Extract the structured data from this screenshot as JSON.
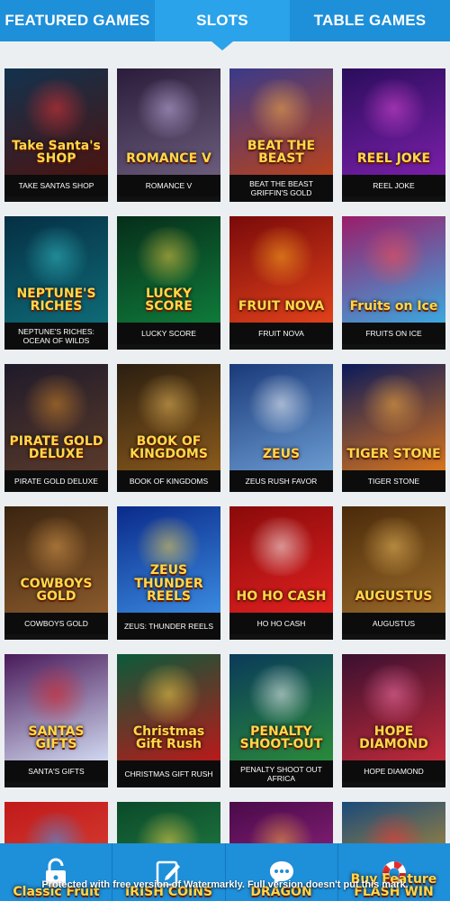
{
  "tabs": [
    {
      "label": "FEATURED GAMES"
    },
    {
      "label": "SLOTS"
    },
    {
      "label": "TABLE GAMES"
    }
  ],
  "games": [
    {
      "caption": "TAKE SANTAS SHOP",
      "logo": "Take Santa's SHOP",
      "bg1": "#12324f",
      "bg2": "#4a1410",
      "glow": "#e33"
    },
    {
      "caption": "ROMANCE V",
      "logo": "ROMANCE V",
      "bg1": "#2a1c3a",
      "bg2": "#6b5c7c",
      "glow": "#c9b6e8"
    },
    {
      "caption": "BEAT THE BEAST GRIFFIN'S GOLD",
      "logo": "BEAT THE BEAST",
      "bg1": "#3a3a8a",
      "bg2": "#b8421c",
      "glow": "#ffb347"
    },
    {
      "caption": "REEL JOKE",
      "logo": "REEL JOKE",
      "bg1": "#2a0d5c",
      "bg2": "#7a1fa8",
      "glow": "#e04bd8"
    },
    {
      "caption": "NEPTUNE'S RICHES: OCEAN OF WILDS",
      "logo": "NEPTUNE'S RICHES",
      "bg1": "#052f44",
      "bg2": "#0f6a77",
      "glow": "#36c1c9"
    },
    {
      "caption": "LUCKY SCORE",
      "logo": "LUCKY SCORE",
      "bg1": "#062e1a",
      "bg2": "#0f7a3a",
      "glow": "#f6d044"
    },
    {
      "caption": "FRUIT NOVA",
      "logo": "FRUIT NOVA",
      "bg1": "#7a0a0a",
      "bg2": "#e0411b",
      "glow": "#ffb020"
    },
    {
      "caption": "FRUITS ON ICE",
      "logo": "Fruits on Ice",
      "bg1": "#9b1c6a",
      "bg2": "#3ba8e0",
      "glow": "#ff4d4d"
    },
    {
      "caption": "PIRATE GOLD DELUXE",
      "logo": "PIRATE GOLD DELUXE",
      "bg1": "#1e1a2a",
      "bg2": "#5a3a2a",
      "glow": "#d98a2a"
    },
    {
      "caption": "BOOK OF KINGDOMS",
      "logo": "BOOK OF KINGDOMS",
      "bg1": "#2a1e10",
      "bg2": "#8a5a1c",
      "glow": "#f0c060"
    },
    {
      "caption": "ZEUS RUSH FAVOR",
      "logo": "ZEUS",
      "bg1": "#1a3a7a",
      "bg2": "#6a9ad0",
      "glow": "#ffffff"
    },
    {
      "caption": "TIGER STONE",
      "logo": "TIGER STONE",
      "bg1": "#0a1a5a",
      "bg2": "#d8741c",
      "glow": "#ffb040"
    },
    {
      "caption": "COWBOYS GOLD",
      "logo": "COWBOYS GOLD",
      "bg1": "#3a2410",
      "bg2": "#8a5a2c",
      "glow": "#e0a050"
    },
    {
      "caption": "ZEUS: THUNDER REELS",
      "logo": "ZEUS THUNDER REELS",
      "bg1": "#0a2a8a",
      "bg2": "#3a8ae0",
      "glow": "#ffd84a"
    },
    {
      "caption": "HO HO CASH",
      "logo": "HO HO CASH",
      "bg1": "#8a0a0a",
      "bg2": "#e02020",
      "glow": "#ffffff"
    },
    {
      "caption": "AUGUSTUS",
      "logo": "AUGUSTUS",
      "bg1": "#4a2a0a",
      "bg2": "#9a6a2a",
      "glow": "#f0c060"
    },
    {
      "caption": "SANTA'S GIFTS",
      "logo": "SANTAS GIFTS",
      "bg1": "#4a1a5a",
      "bg2": "#d0d8f0",
      "glow": "#e02020"
    },
    {
      "caption": "CHRISTMAS GIFT RUSH",
      "logo": "Christmas Gift Rush",
      "bg1": "#0a5a3a",
      "bg2": "#b81a1a",
      "glow": "#ffd84a"
    },
    {
      "caption": "PENALTY SHOOT OUT AFRICA",
      "logo": "PENALTY SHOOT-OUT",
      "bg1": "#0a3a5a",
      "bg2": "#2a8a3a",
      "glow": "#ffffff"
    },
    {
      "caption": "HOPE DIAMOND",
      "logo": "HOPE DIAMOND",
      "bg1": "#3a1030",
      "bg2": "#c02a3a",
      "glow": "#ff7ab0"
    },
    {
      "caption": "",
      "logo": "Classic Fruit",
      "bg1": "#c01a1a",
      "bg2": "#e04a3a",
      "glow": "#3aa0ff"
    },
    {
      "caption": "",
      "logo": "IRISH COINS",
      "bg1": "#0a4a2a",
      "bg2": "#2a8a4a",
      "glow": "#ffd84a"
    },
    {
      "caption": "",
      "logo": "DRAGON",
      "bg1": "#4a0a4a",
      "bg2": "#a02a8a",
      "glow": "#ffb040"
    },
    {
      "caption": "",
      "logo": "Buy Feature FLASH WIN",
      "bg1": "#1a4a7a",
      "bg2": "#e0a020",
      "glow": "#ff3030"
    }
  ],
  "bottom_bar": [
    {
      "icon": "lock-icon"
    },
    {
      "icon": "edit-icon"
    },
    {
      "icon": "chat-icon"
    },
    {
      "icon": "lifebuoy-icon"
    }
  ],
  "watermark": "Protected with free version of Watermarkly. Full version doesn't put this mark."
}
